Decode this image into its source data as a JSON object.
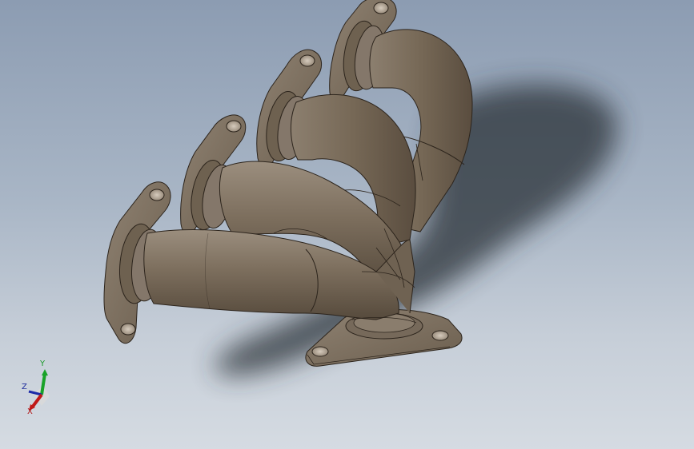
{
  "viewport": {
    "background_top": "#8c9cb2",
    "background_bottom": "#d5dbe2",
    "model_color": "#7b6d5c",
    "edge_color": "#2c241c",
    "shadow_color": "#2a2f36"
  },
  "triad": {
    "x_label": "X",
    "y_label": "Y",
    "z_label": "Z",
    "x_color": "#c01818",
    "y_color": "#18a228",
    "z_color": "#1c2aa8"
  }
}
